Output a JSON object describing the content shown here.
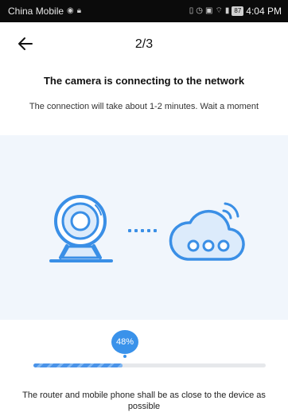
{
  "status_bar": {
    "carrier": "China Mobile",
    "time": "4:04 PM",
    "battery": "87"
  },
  "header": {
    "step": "2/3"
  },
  "main": {
    "title": "The camera is connecting to the network",
    "subtitle": "The connection will take about 1-2 minutes. Wait a moment",
    "hint": "The router and mobile phone shall be as close to the device as possible"
  },
  "progress": {
    "percent": 48,
    "label": "48%"
  },
  "colors": {
    "accent": "#3a92ea",
    "panel_bg": "#f1f6fc"
  },
  "icons": {
    "camera": "camera-icon",
    "dots": "connecting-dots-icon",
    "cloud": "cloud-wifi-icon",
    "back": "arrow-left-icon"
  }
}
